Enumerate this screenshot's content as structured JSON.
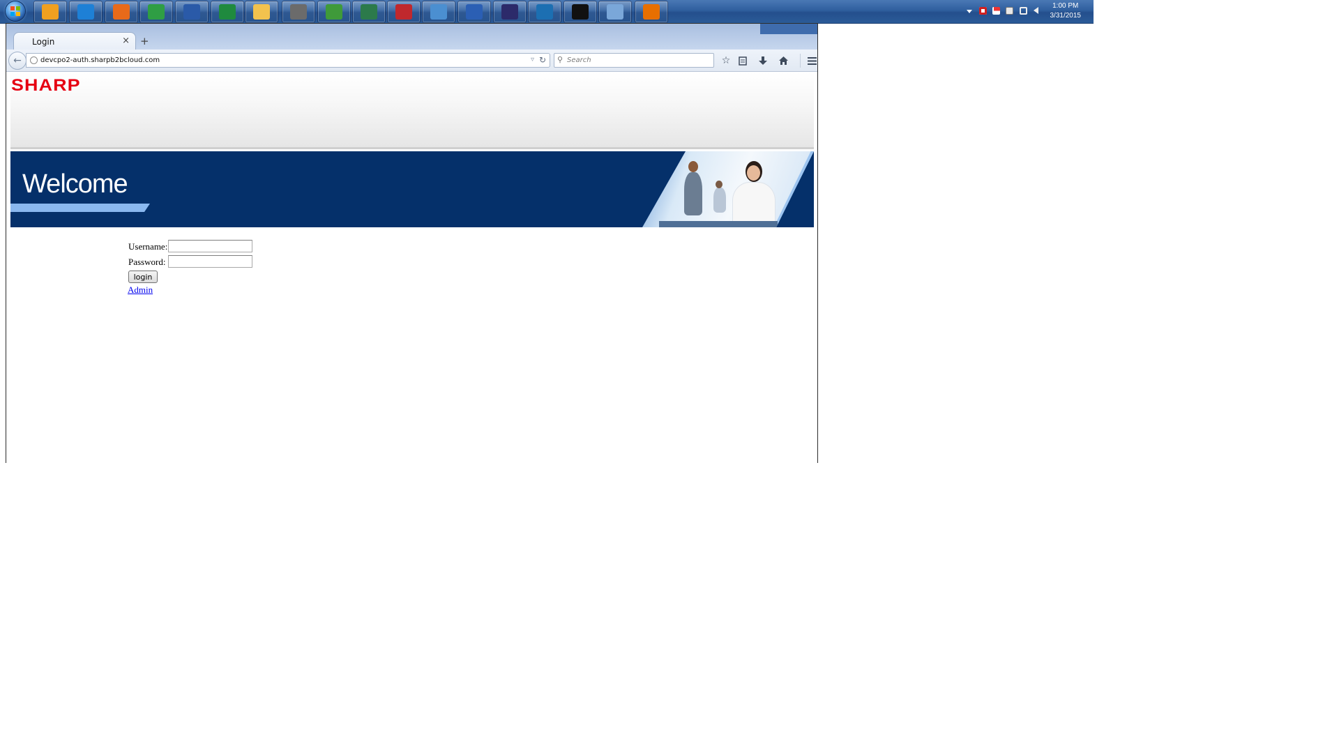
{
  "taskbar": {
    "start_icon": "windows-orb-icon",
    "apps": [
      {
        "name": "outlook-icon",
        "color": "#f0a020"
      },
      {
        "name": "internet-explorer-icon",
        "color": "#1e80d6"
      },
      {
        "name": "firefox-icon",
        "color": "#e86a1a"
      },
      {
        "name": "chrome-icon",
        "color": "#2f9e44"
      },
      {
        "name": "visio-icon",
        "color": "#2a5aa8"
      },
      {
        "name": "excel-icon",
        "color": "#1f8a3e"
      },
      {
        "name": "file-explorer-icon",
        "color": "#f2c24e"
      },
      {
        "name": "archive-icon",
        "color": "#6b6b6b"
      },
      {
        "name": "chart-tool-icon",
        "color": "#3f9a3a"
      },
      {
        "name": "monitor-icon",
        "color": "#2c7a4b"
      },
      {
        "name": "media-player-icon",
        "color": "#c0282d"
      },
      {
        "name": "remote-desktop-icon",
        "color": "#4b8fd1"
      },
      {
        "name": "word-icon",
        "color": "#2b5fb4"
      },
      {
        "name": "eclipse-icon",
        "color": "#2c2a6a"
      },
      {
        "name": "chat-icon",
        "color": "#1c6fb2"
      },
      {
        "name": "command-prompt-icon",
        "color": "#111111"
      },
      {
        "name": "paint-icon",
        "color": "#7aa7d9"
      },
      {
        "name": "java-icon",
        "color": "#e76f00"
      }
    ],
    "tray_icons": [
      "show-hidden-icons-icon",
      "antivirus-icon",
      "action-center-flag-icon",
      "usb-icon",
      "network-icon",
      "volume-icon"
    ],
    "clock": {
      "time": "1:00 PM",
      "date": "3/31/2015"
    }
  },
  "browser": {
    "tab_title": "Login",
    "tab_close": "×",
    "new_tab": "+",
    "url": "devcpo2-auth.sharpb2bcloud.com",
    "search_placeholder": "Search",
    "toolbar_icons": [
      "bookmark-star-icon",
      "reading-list-icon",
      "downloads-icon",
      "home-icon",
      "menu-icon"
    ]
  },
  "page": {
    "brand": "SHARP",
    "brand_color": "#e60012",
    "banner_text": "Welcome",
    "banner_color": "#05306a",
    "form": {
      "username_label": "Username:",
      "username_value": "",
      "password_label": "Password:",
      "password_value": "",
      "login_button": "login",
      "admin_link": "Admin"
    }
  }
}
